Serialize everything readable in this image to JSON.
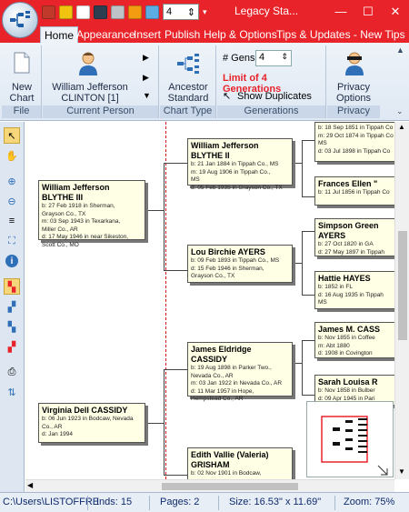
{
  "window": {
    "title": "Legacy Sta...",
    "gens_value": "4",
    "minimize_glyph": "—",
    "maximize_glyph": "☐",
    "close_glyph": "✕"
  },
  "tabs": [
    "Home",
    "Appearance",
    "Insert",
    "Publish",
    "Help & Options",
    "Tips & Updates - New Tips"
  ],
  "ribbon": {
    "file": {
      "new_chart": "New Chart",
      "group": "File"
    },
    "current_person": {
      "name": "William Jefferson CLINTON [1]",
      "group": "Current Person"
    },
    "chart_type": {
      "button": "Ancestor Standard",
      "group": "Chart Type"
    },
    "generations": {
      "gens_label": "# Gens",
      "gens_value": "4",
      "limit_text": "Limit of 4 Generations",
      "show_duplicates": "Show Duplicates",
      "group": "Generations"
    },
    "privacy": {
      "button": "Privacy Options",
      "group": "Privacy"
    }
  },
  "people": [
    {
      "name": "William Jefferson BLYTHE III",
      "lines": [
        "b: 27 Feb 1918 in Sherman,",
        "Grayson Co., TX",
        "m: 03 Sep 1943 in Texarkana,",
        "Miller Co., AR",
        "d: 17 May 1946 in near Sikeston,",
        "Scott Co., MO"
      ]
    },
    {
      "name": "Virginia Dell CASSIDY",
      "lines": [
        "b: 06 Jun 1923 in Bodcaw, Nevada",
        "Co., AR",
        "d: Jan 1994"
      ]
    },
    {
      "name": "William Jefferson BLYTHE II",
      "lines": [
        "b: 21 Jan 1884 in Tippah Co., MS",
        "m: 19 Aug 1906 in Tippah Co.,",
        "MS",
        "d: 05 Feb 1935 in Grayson Co., TX"
      ]
    },
    {
      "name": "Lou Birchie AYERS",
      "lines": [
        "b: 09 Feb 1893 in Tippah Co., MS",
        "d: 15 Feb 1946 in Sherman,",
        "Grayson Co., TX"
      ]
    },
    {
      "name": "James Eldridge CASSIDY",
      "lines": [
        "b: 19 Aug 1898 in Parker Two.,",
        "Nevada Co., AR",
        "m: 03 Jan 1922 in Nevada Co., AR",
        "d: 11 Mar 1957 in Hope,",
        "Hempstead Co., AR"
      ]
    },
    {
      "name": "Edith Vallie (Valeria) GRISHAM",
      "lines": [
        "b: 02 Nov 1901 in Bodcaw,"
      ]
    },
    {
      "name": "",
      "lines": [
        "b: 18 Sep 1851 in Tippah Co",
        "m: 29 Oct 1874 in Tippah Co",
        "MS",
        "d: 03 Jul 1898 in Tippah Co"
      ]
    },
    {
      "name": "Frances Ellen \"",
      "lines": [
        "b: 11 Jul 1856 in Tippah Co"
      ]
    },
    {
      "name": "Simpson Green AYERS",
      "lines": [
        "b: 27 Oct 1820 in GA",
        "d: 27 May 1897 in Tippah"
      ]
    },
    {
      "name": "Hattie HAYES",
      "lines": [
        "b: 1852 in FL",
        "d: 16 Aug 1935 in Tippah",
        "MS"
      ]
    },
    {
      "name": "James M. CASS",
      "lines": [
        "b: Nov 1855 in Coffee",
        "m: Abt 1880",
        "d: 1908 in Covington"
      ]
    },
    {
      "name": "Sarah Louisa R",
      "lines": [
        "b: Nov 1858 in Bulber",
        "d: 09 Apr 1945 in Pari"
      ]
    }
  ],
  "status": {
    "path": "C:\\Users\\LISTOFFRE",
    "inds": "Inds: 15",
    "pages": "Pages: 2",
    "size": "Size: 16.53\" x 11.69\"",
    "zoom": "Zoom: 75%"
  },
  "colors": {
    "titlebar": "#e8242a",
    "limit_text": "#e8242a",
    "box_fill": "#ffffe6",
    "status_text": "#0e2a6e"
  },
  "icons": [
    "app-orb-icon",
    "new-doc-icon",
    "open-icon",
    "save-icon",
    "print-icon",
    "person-icon",
    "chart-icon",
    "pointer-icon",
    "hand-icon",
    "zoom-in-icon",
    "zoom-out-icon",
    "fit-icon",
    "info-icon",
    "privacy-icon",
    "refresh-icon"
  ]
}
